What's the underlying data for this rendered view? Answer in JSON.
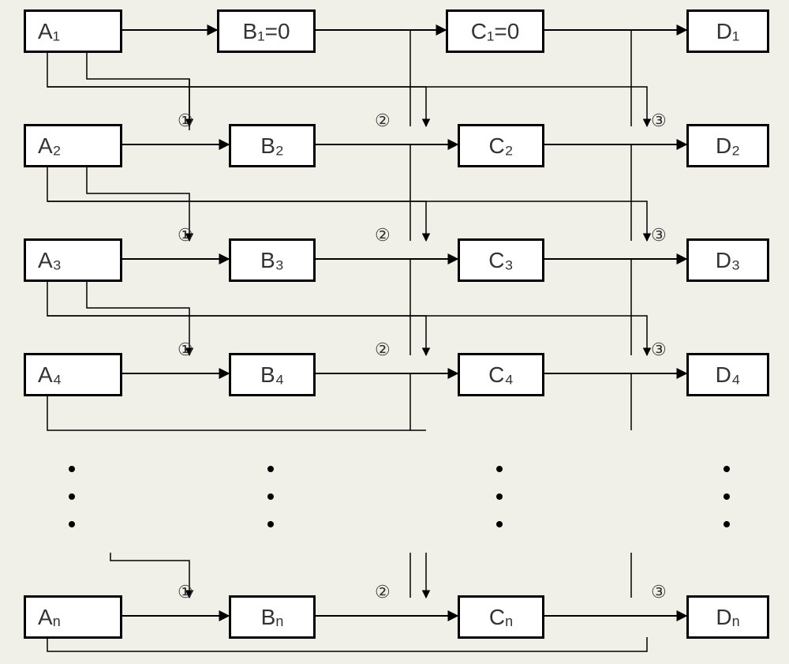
{
  "diagram": {
    "type": "flow-network",
    "rows": [
      "1",
      "2",
      "3",
      "4",
      "n"
    ],
    "columns": [
      "A",
      "B",
      "C",
      "D"
    ],
    "nodes": {
      "A1": "A₁",
      "B1": "B₁=0",
      "C1": "C₁=0",
      "D1": "D₁",
      "A2": "A₂",
      "B2": "B₂",
      "C2": "C₂",
      "D2": "D₂",
      "A3": "A₃",
      "B3": "B₃",
      "C3": "C₃",
      "D3": "D₃",
      "A4": "A₄",
      "B4": "B₄",
      "C4": "C₄",
      "D4": "D₄",
      "An_pre": "A",
      "An_sub": "n",
      "Bn_pre": "B",
      "Bn_sub": "n",
      "Cn_pre": "C",
      "Cn_sub": "n",
      "Dn_pre": "D",
      "Dn_sub": "n"
    },
    "edge_labels": {
      "l1": "①",
      "l2": "②",
      "l3": "③"
    },
    "ellipsis": "•"
  }
}
